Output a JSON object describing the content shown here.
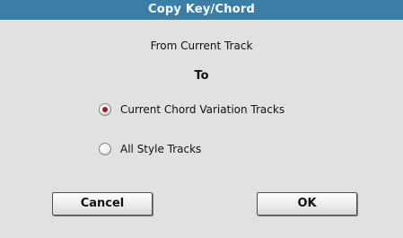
{
  "dialog": {
    "title": "Copy Key/Chord",
    "from_label": "From Current Track",
    "to_label": "To",
    "options": [
      {
        "label": "Current Chord Variation Tracks",
        "selected": true
      },
      {
        "label": "All Style Tracks",
        "selected": false
      }
    ],
    "buttons": {
      "cancel": "Cancel",
      "ok": "OK"
    }
  },
  "colors": {
    "titlebar": "#3a7ea8",
    "background": "#e1e1e1",
    "radio_selected": "#b21515"
  }
}
